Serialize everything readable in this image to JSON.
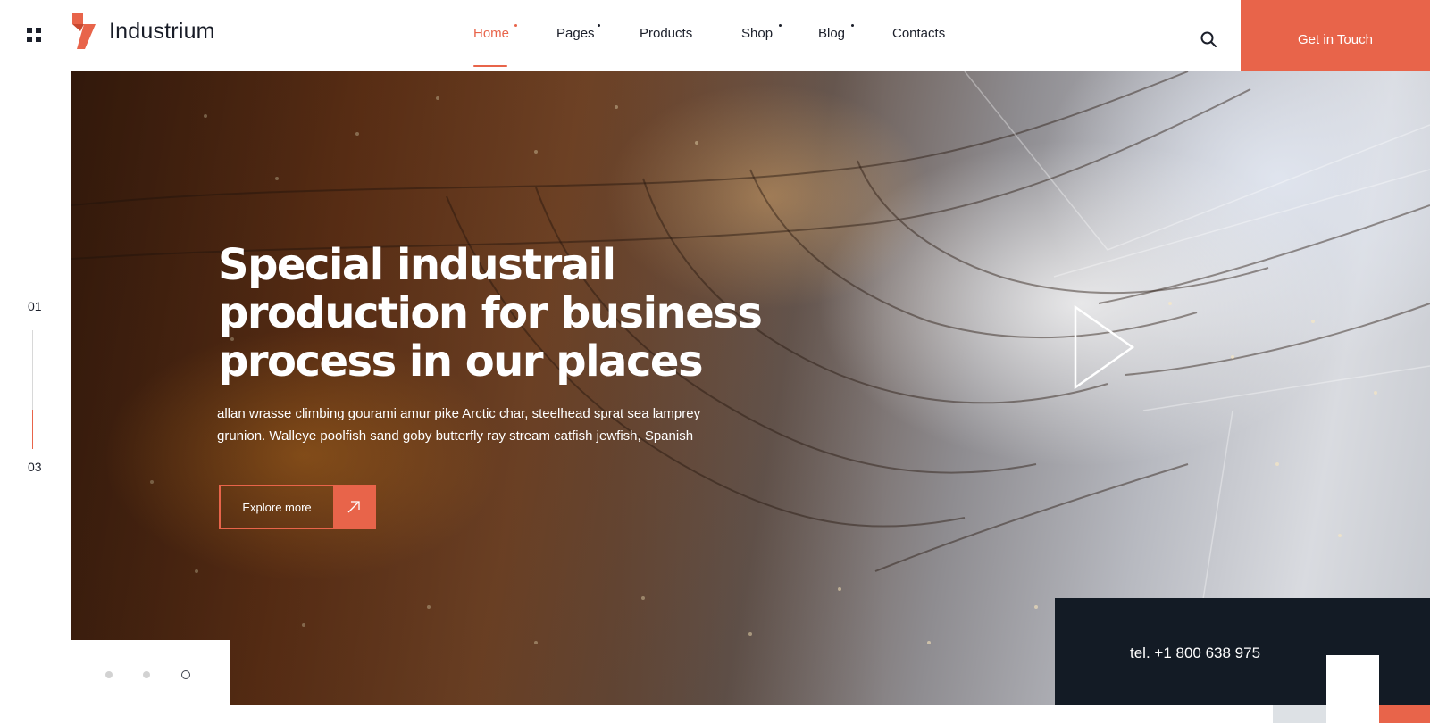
{
  "brand": {
    "name": "Industrium",
    "accent_color": "#e8644a",
    "dark_color": "#131b25"
  },
  "header": {
    "menu_icon": "grid-icon",
    "nav": [
      {
        "label": "Home",
        "active": true,
        "has_dropdown": true
      },
      {
        "label": "Pages",
        "active": false,
        "has_dropdown": true
      },
      {
        "label": "Products",
        "active": false,
        "has_dropdown": false
      },
      {
        "label": "Shop",
        "active": false,
        "has_dropdown": true
      },
      {
        "label": "Blog",
        "active": false,
        "has_dropdown": true
      },
      {
        "label": "Contacts",
        "active": false,
        "has_dropdown": false
      }
    ],
    "search_icon": "search-icon",
    "cta_label": "Get in Touch"
  },
  "slider": {
    "current": "01",
    "total": "03",
    "progress": 0.33,
    "dots_count": 3,
    "active_dot": 3
  },
  "hero": {
    "title_before": "Special industrail production ",
    "title_highlight": "for business",
    "title_after": " process in our places",
    "description": "allan wrasse climbing gourami amur pike Arctic char, steelhead sprat sea lamprey grunion. Walleye poolfish sand goby butterfly ray stream catfish jewfish, Spanish",
    "button_label": "Explore more",
    "button_icon": "arrow-up-right-icon",
    "play_icon": "play-icon"
  },
  "contact": {
    "phone": "tel. +1 800 638 975"
  }
}
